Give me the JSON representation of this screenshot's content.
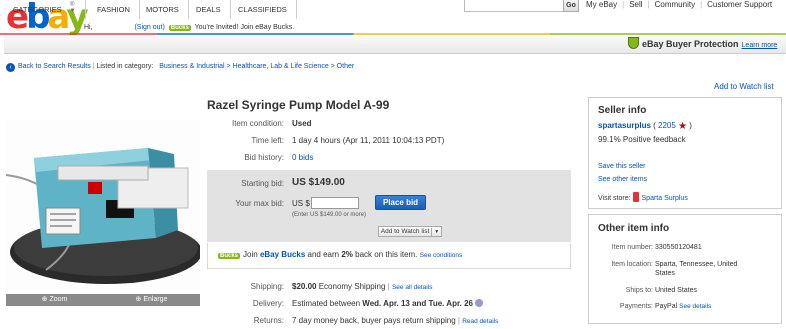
{
  "header": {
    "logo_letters": [
      "e",
      "b",
      "a",
      "y"
    ],
    "reg_mark": "®",
    "greeting": "Hi,",
    "sign_out": "(Sign out)",
    "bucks_badge": "Bucks",
    "invite_text": "You're Invited! Join eBay Bucks.",
    "go_button": "Go",
    "top_links": [
      "My eBay",
      "Sell",
      "Community",
      "Customer Support"
    ]
  },
  "nav": {
    "items": [
      "CATEGORIES",
      "FASHION",
      "MOTORS",
      "DEALS",
      "CLASSIFIEDS"
    ],
    "buyer_protection": "eBay Buyer Protection",
    "learn_more": "Learn more"
  },
  "breadcrumb": {
    "back": "Back to Search Results",
    "listed_in": "Listed in category:",
    "path": "Business & Industrial > Healthcare, Lab & Life Science > Other"
  },
  "watch_list_link": "Add to Watch list",
  "photo": {
    "zoom": "Zoom",
    "enlarge": "Enlarge"
  },
  "item": {
    "title": "Razel Syringe Pump Model A-99",
    "condition_label": "Item condition:",
    "condition": "Used",
    "time_left_label": "Time left:",
    "time_left": "1 day 4 hours (Apr 11, 2011 10:04:13 PDT)",
    "bid_history_label": "Bid history:",
    "bid_history": "0 bids",
    "starting_bid_label": "Starting bid:",
    "starting_bid": "US $149.00",
    "max_bid_label": "Your max bid:",
    "currency": "US $",
    "place_bid": "Place bid",
    "enter_hint": "(Enter US $149.00 or more)",
    "add_watch": "Add to Watch list",
    "bucks_text_1": "Join",
    "bucks_text_2": "eBay Bucks",
    "bucks_text_3": "and earn",
    "bucks_text_4": "2%",
    "bucks_text_5": "back on this item.",
    "see_conditions": "See conditions",
    "shipping_label": "Shipping:",
    "shipping_price": "$20.00",
    "shipping_method": "Economy Shipping",
    "see_all_details": "See all details",
    "delivery_label": "Delivery:",
    "delivery_prefix": "Estimated between",
    "delivery_dates": "Wed. Apr. 13 and Tue. Apr. 26",
    "returns_label": "Returns:",
    "returns": "7 day money back, buyer pays return shipping",
    "read_details": "Read details"
  },
  "seller": {
    "heading": "Seller info",
    "name": "spartasurplus",
    "score": "2205",
    "feedback": "99.1% Positive feedback",
    "save_seller": "Save this seller",
    "see_other": "See other items",
    "visit_store_label": "Visit store:",
    "store_name": "Sparta Surplus"
  },
  "other_info": {
    "heading": "Other item info",
    "item_number_label": "Item number:",
    "item_number": "330550120481",
    "location_label": "Item location:",
    "location_line1": "Sparta, Tennessee, United",
    "location_line2": "States",
    "ships_to_label": "Ships to:",
    "ships_to": "United States",
    "payments_label": "Payments:",
    "payments": "PayPal",
    "see_details": "See details"
  }
}
